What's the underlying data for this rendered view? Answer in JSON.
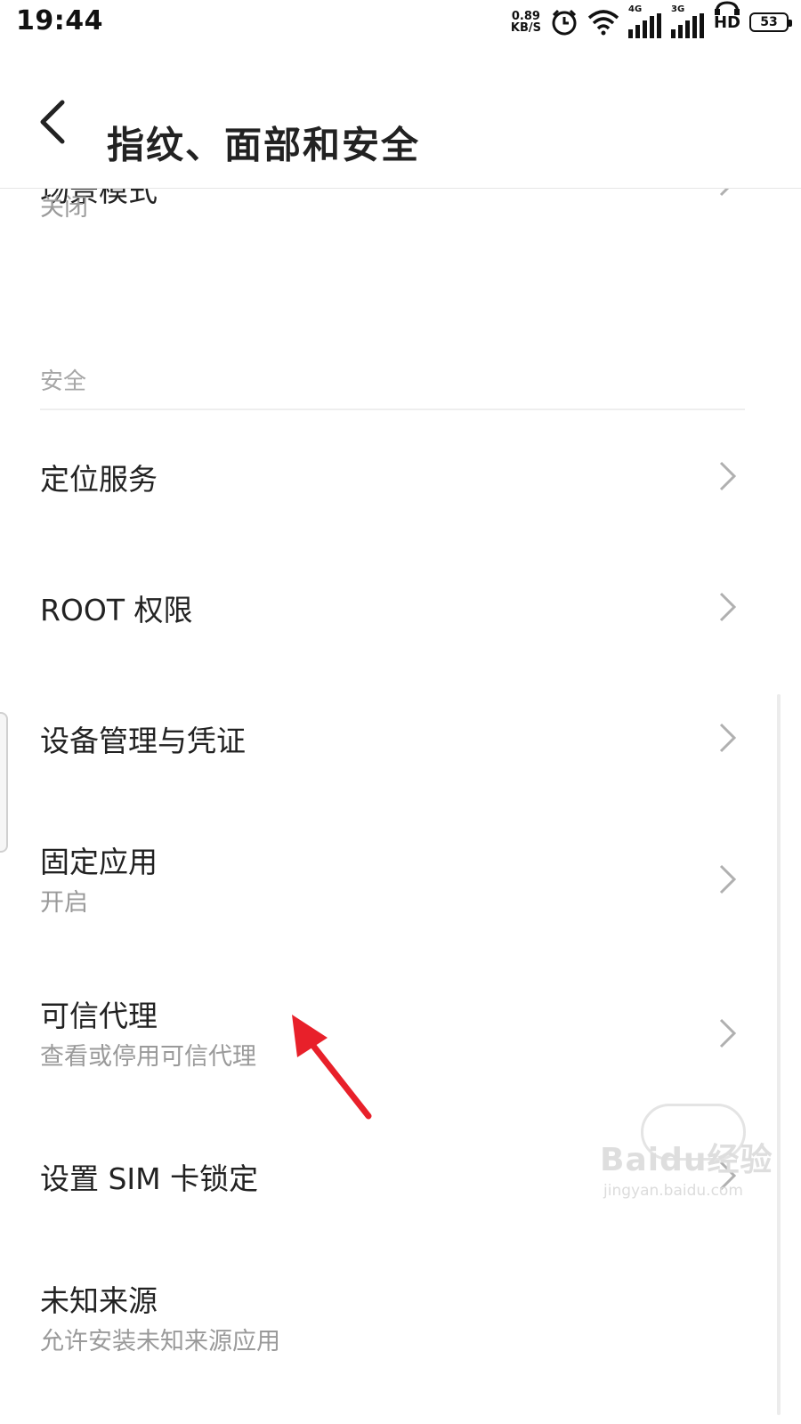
{
  "status_bar": {
    "time": "19:44",
    "net_speed_value": "0.89",
    "net_speed_unit": "KB/S",
    "signal1_label": "4G",
    "signal2_label": "3G",
    "hd_label": "HD",
    "battery": "53",
    "icons": [
      "alarm-icon",
      "wifi-icon",
      "signal-4g-icon",
      "signal-3g-icon",
      "hd-voice-icon",
      "battery-icon"
    ]
  },
  "header": {
    "back_icon": "back-arrow-icon",
    "title": "指纹、面部和安全"
  },
  "list": {
    "partial_item": {
      "title": "场景模式",
      "subtitle": "关闭"
    },
    "section_label": "安全",
    "items": [
      {
        "title": "定位服务",
        "subtitle": ""
      },
      {
        "title": "ROOT 权限",
        "subtitle": ""
      },
      {
        "title": "设备管理与凭证",
        "subtitle": ""
      },
      {
        "title": "固定应用",
        "subtitle": "开启"
      },
      {
        "title": "可信代理",
        "subtitle": "查看或停用可信代理"
      },
      {
        "title": "设置 SIM 卡锁定",
        "subtitle": ""
      },
      {
        "title": "未知来源",
        "subtitle": "允许安装未知来源应用"
      }
    ]
  },
  "watermark": {
    "brand": "Baidu经验",
    "url": "jingyan.baidu.com"
  },
  "colors": {
    "annotation_arrow": "#e8202a",
    "primary_text": "#222222",
    "secondary_text": "#9a9a9a"
  }
}
